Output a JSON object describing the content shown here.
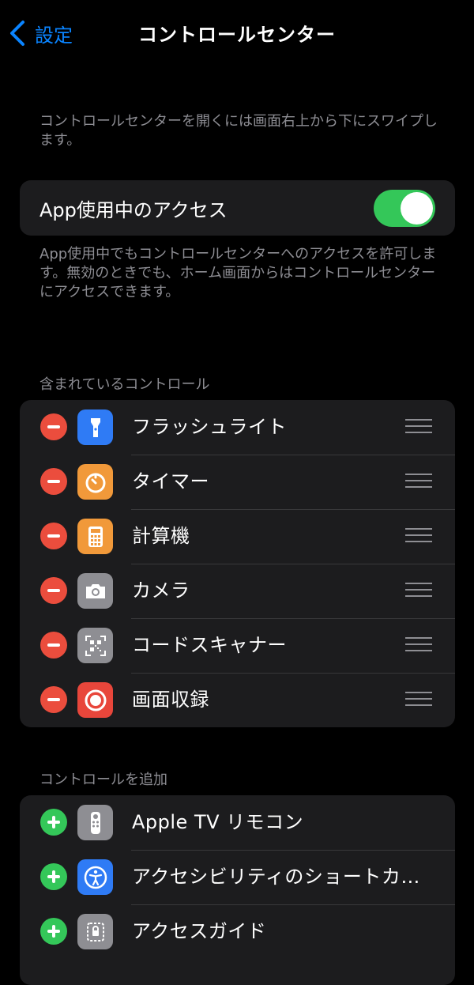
{
  "nav": {
    "back_label": "設定",
    "title": "コントロールセンター"
  },
  "intro_text": "コントロールセンターを開くには画面右上から下にスワイプします。",
  "access": {
    "label": "App使用中のアクセス",
    "enabled": true,
    "footnote": "App使用中でもコントロールセンターへのアクセスを許可します。無効のときでも、ホーム画面からはコントロールセンターにアクセスできます。"
  },
  "included": {
    "header": "含まれているコントロール",
    "items": [
      {
        "label": "フラッシュライト",
        "icon": "flashlight-icon",
        "color": "#2f7bf5"
      },
      {
        "label": "タイマー",
        "icon": "timer-icon",
        "color": "#f1993a"
      },
      {
        "label": "計算機",
        "icon": "calculator-icon",
        "color": "#f1993a"
      },
      {
        "label": "カメラ",
        "icon": "camera-icon",
        "color": "#8e8e93"
      },
      {
        "label": "コードスキャナー",
        "icon": "qr-code-icon",
        "color": "#8e8e93"
      },
      {
        "label": "画面収録",
        "icon": "screen-record-icon",
        "color": "#e8463b"
      }
    ]
  },
  "more": {
    "header": "コントロールを追加",
    "items": [
      {
        "label": "Apple TV リモコン",
        "icon": "tv-remote-icon",
        "color": "#8e8e93"
      },
      {
        "label": "アクセシビリティのショートカ…",
        "icon": "accessibility-icon",
        "color": "#2f7bf5"
      },
      {
        "label": "アクセスガイド",
        "icon": "guided-access-icon",
        "color": "#8e8e93"
      }
    ]
  }
}
